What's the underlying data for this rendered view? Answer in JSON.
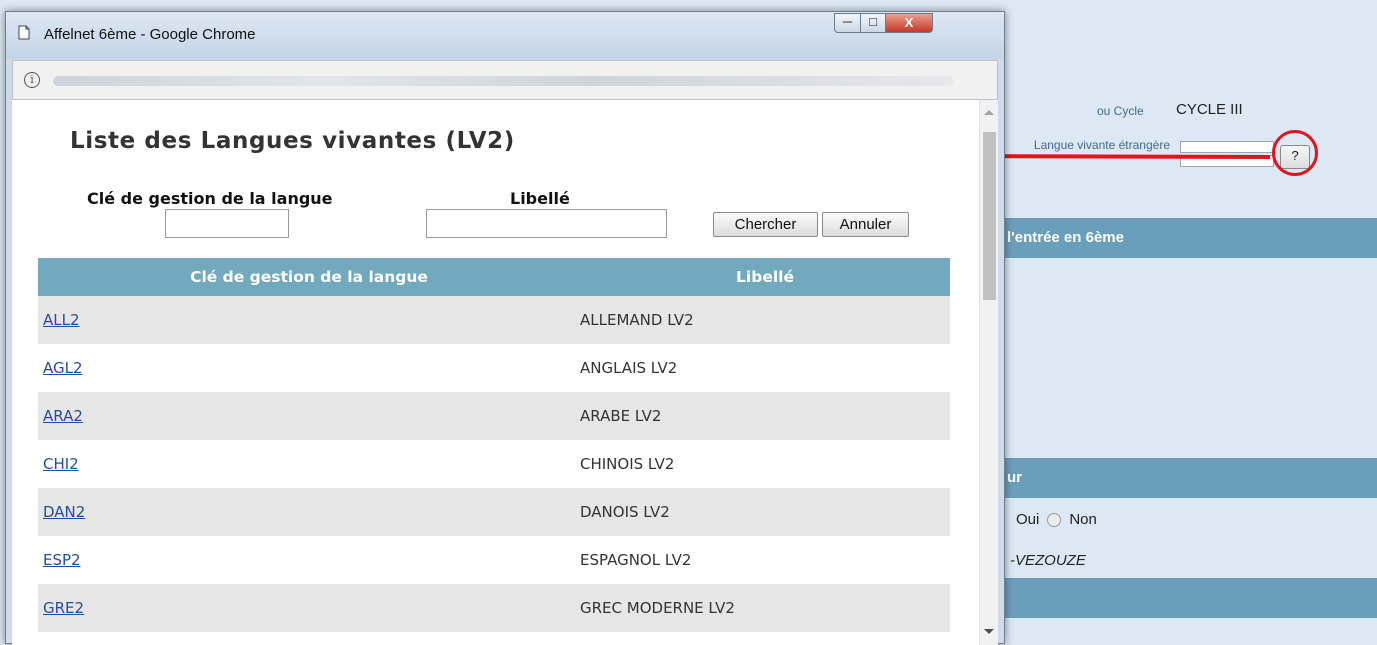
{
  "background": {
    "cycle_label": "ou Cycle",
    "cycle_value": "CYCLE III",
    "lv_label": "Langue vivante étrangère",
    "help_button_label": "?",
    "section_1": "l'entrée en 6ème",
    "section_2": "ur",
    "radio_yes": "Oui",
    "radio_no": "Non",
    "school_name": "-VEZOUZE"
  },
  "window": {
    "title": "Affelnet 6ème - Google Chrome",
    "close_label": "X",
    "max_label": "□",
    "min_label": "─"
  },
  "dialog": {
    "title": "Liste des Langues vivantes (LV2)",
    "filter_key_label": "Clé de gestion de la langue",
    "filter_lib_label": "Libellé",
    "search_button": "Chercher",
    "cancel_button": "Annuler"
  },
  "table": {
    "headers": [
      "Clé de gestion de la langue",
      "Libellé"
    ],
    "rows": [
      {
        "key": "ALL2",
        "label": "ALLEMAND LV2"
      },
      {
        "key": "AGL2",
        "label": "ANGLAIS LV2"
      },
      {
        "key": "ARA2",
        "label": "ARABE LV2"
      },
      {
        "key": "CHI2",
        "label": "CHINOIS LV2"
      },
      {
        "key": "DAN2",
        "label": "DANOIS LV2"
      },
      {
        "key": "ESP2",
        "label": "ESPAGNOL LV2"
      },
      {
        "key": "GRE2",
        "label": "GREC MODERNE LV2"
      }
    ]
  },
  "colors": {
    "header_bg": "#72a9bf",
    "link": "#1d4f9c",
    "annotation_red": "#e0141d"
  }
}
